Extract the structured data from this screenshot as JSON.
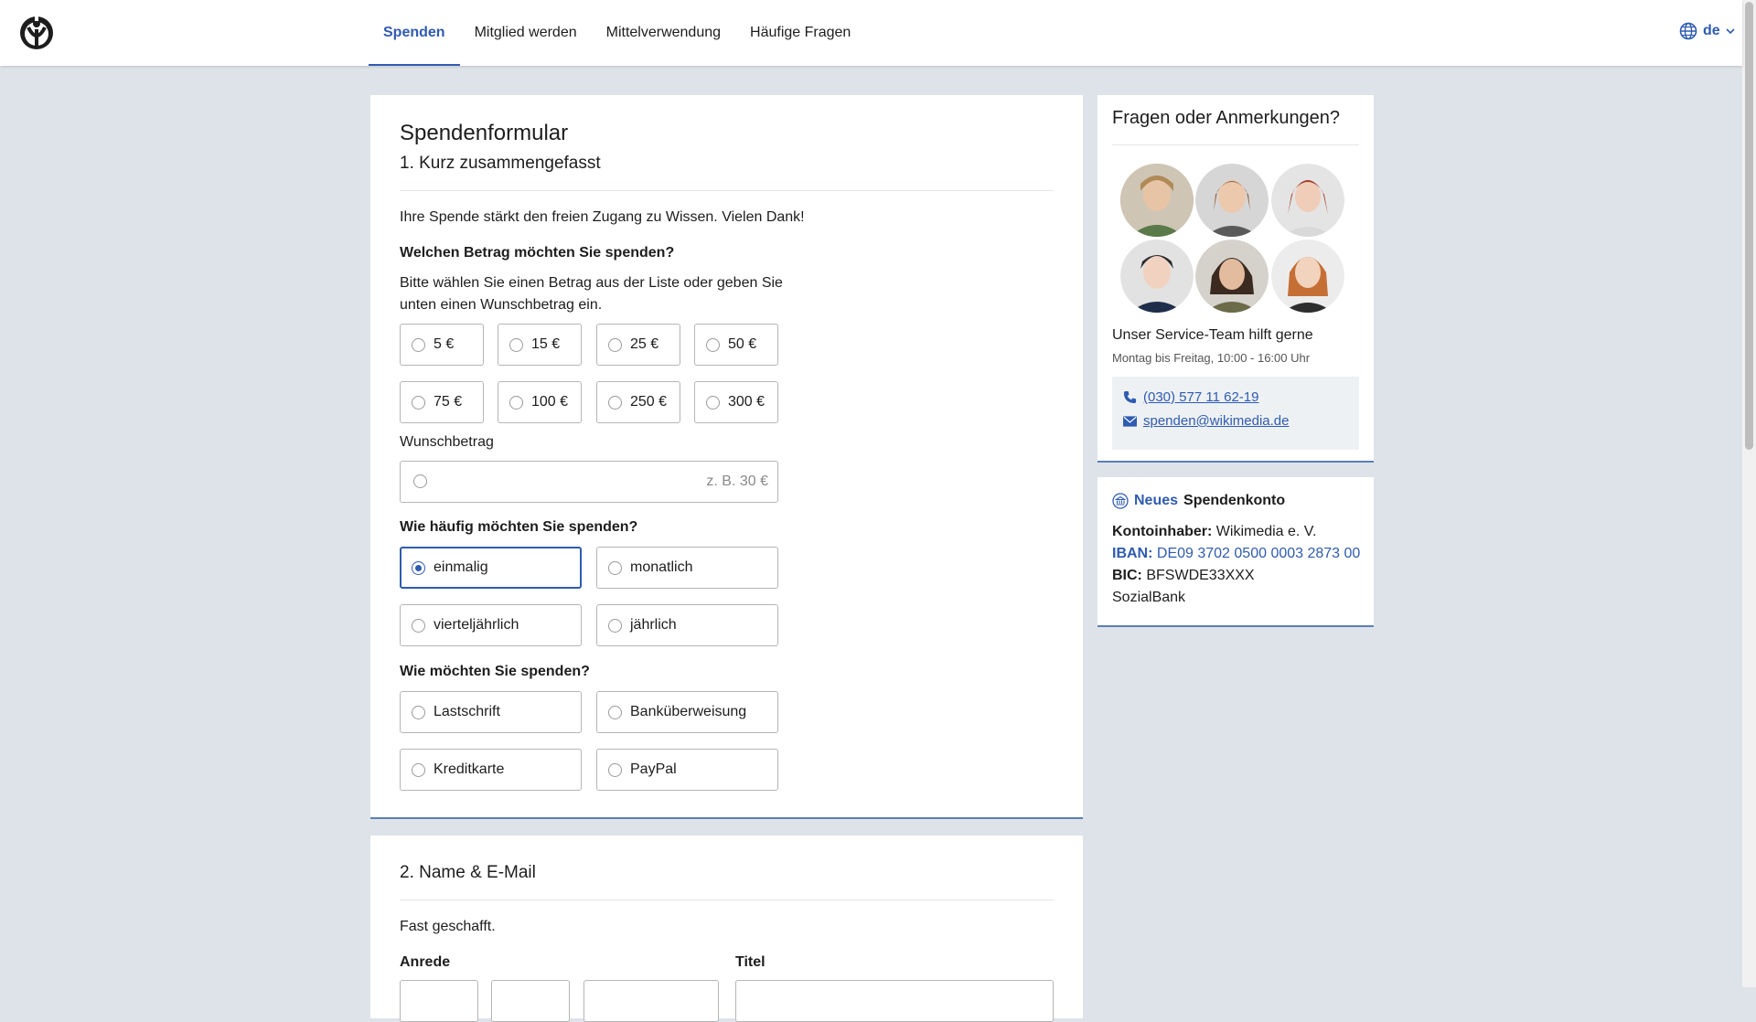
{
  "header": {
    "nav": [
      {
        "label": "Spenden",
        "active": true
      },
      {
        "label": "Mitglied werden",
        "active": false
      },
      {
        "label": "Mittelverwendung",
        "active": false
      },
      {
        "label": "Häufige Fragen",
        "active": false
      }
    ],
    "lang": "de"
  },
  "form": {
    "title": "Spendenformular",
    "section1_title": "1. Kurz zusammengefasst",
    "intro": "Ihre Spende stärkt den freien Zugang zu Wissen. Vielen Dank!",
    "amount_label": "Welchen Betrag möchten Sie spenden?",
    "amount_help_line1": "Bitte wählen Sie einen Betrag aus der Liste oder geben Sie",
    "amount_help_line2": "unten einen Wunschbetrag ein.",
    "amounts": [
      "5 €",
      "15 €",
      "25 €",
      "50 €",
      "75 €",
      "100 €",
      "250 €",
      "300 €"
    ],
    "wish_label": "Wunschbetrag",
    "wish_placeholder": "z. B. 30 €",
    "interval_label": "Wie häufig möchten Sie spenden?",
    "intervals": [
      "einmalig",
      "monatlich",
      "vierteljährlich",
      "jährlich"
    ],
    "selected_interval": "einmalig",
    "payment_label": "Wie möchten Sie spenden?",
    "payments": [
      "Lastschrift",
      "Banküberweisung",
      "Kreditkarte",
      "PayPal"
    ],
    "section2_title": "2. Name & E-Mail",
    "section2_intro": "Fast geschafft.",
    "salutation_label": "Anrede",
    "title_label": "Titel"
  },
  "sidebar": {
    "questions_title": "Fragen oder Anmerkungen?",
    "team_text": "Unser Service-Team hilft gerne",
    "hours": "Montag bis Freitag, 10:00 - 16:00 Uhr",
    "phone": "(030) 577 11 62-19",
    "email": "spenden@wikimedia.de",
    "account_new": "Neues",
    "account_title": "Spendenkonto",
    "holder_label": "Kontoinhaber:",
    "holder": "Wikimedia e. V.",
    "iban_label": "IBAN:",
    "iban": "DE09 3702 0500 0003 2873 00",
    "bic_label": "BIC:",
    "bic": "BFSWDE33XXX",
    "bank": "SozialBank"
  },
  "colors": {
    "accent": "#2f5bb0",
    "page_bg": "#dde3e8"
  }
}
